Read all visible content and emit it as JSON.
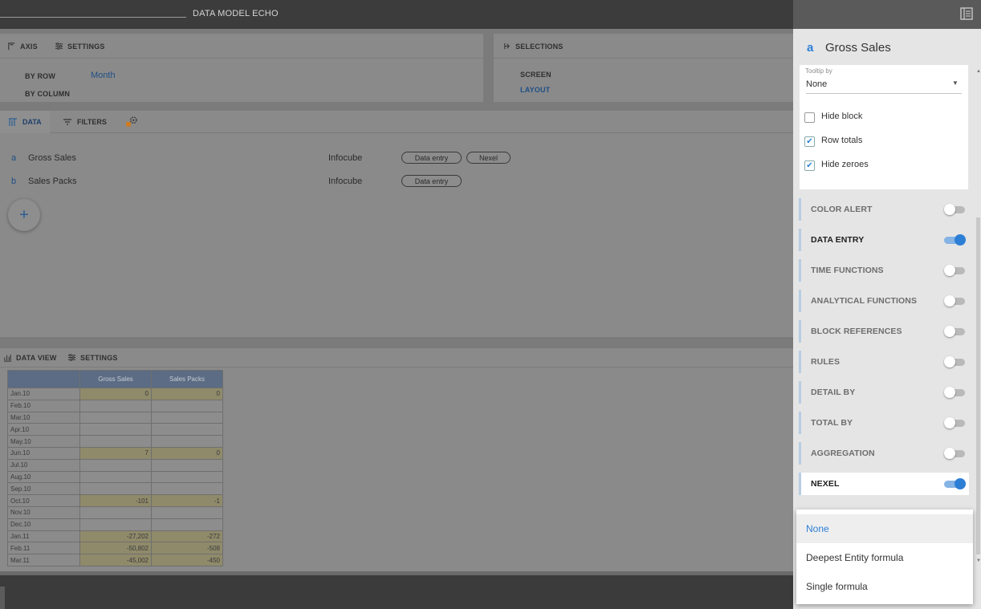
{
  "topbar": {
    "title": "DATA MODEL  ECHO"
  },
  "axis_panel": {
    "tab_axis": "AXIS",
    "tab_settings": "SETTINGS",
    "by_row_label": "BY ROW",
    "by_row_value": "Month",
    "by_column_label": "BY COLUMN"
  },
  "selections_panel": {
    "title": "SELECTIONS",
    "screen_label": "SCREEN",
    "layout_label": "LAYOUT"
  },
  "data_panel": {
    "tab_data": "DATA",
    "tab_filters": "FILTERS",
    "rows": [
      {
        "letter": "a",
        "name": "Gross Sales",
        "source": "Infocube",
        "pills": [
          "Data entry",
          "Nexel"
        ]
      },
      {
        "letter": "b",
        "name": "Sales Packs",
        "source": "Infocube",
        "pills": [
          "Data entry"
        ]
      }
    ],
    "add_label": "+"
  },
  "data_view": {
    "tab_data_view": "DATA VIEW",
    "tab_settings": "SETTINGS",
    "columns": [
      "Gross Sales",
      "Sales Packs"
    ],
    "rows": [
      {
        "label": "Jan.10",
        "v1": "0",
        "v2": "0",
        "hl": true
      },
      {
        "label": "Feb.10",
        "v1": "",
        "v2": "",
        "hl": false
      },
      {
        "label": "Mar.10",
        "v1": "",
        "v2": "",
        "hl": false
      },
      {
        "label": "Apr.10",
        "v1": "",
        "v2": "",
        "hl": false
      },
      {
        "label": "May.10",
        "v1": "",
        "v2": "",
        "hl": false
      },
      {
        "label": "Jun.10",
        "v1": "7",
        "v2": "0",
        "hl": true
      },
      {
        "label": "Jul.10",
        "v1": "",
        "v2": "",
        "hl": false
      },
      {
        "label": "Aug.10",
        "v1": "",
        "v2": "",
        "hl": false
      },
      {
        "label": "Sep.10",
        "v1": "",
        "v2": "",
        "hl": false
      },
      {
        "label": "Oct.10",
        "v1": "-101",
        "v2": "-1",
        "hl": true
      },
      {
        "label": "Nov.10",
        "v1": "",
        "v2": "",
        "hl": false
      },
      {
        "label": "Dec.10",
        "v1": "",
        "v2": "",
        "hl": false
      },
      {
        "label": "Jan.11",
        "v1": "-27,202",
        "v2": "-272",
        "hl": true
      },
      {
        "label": "Feb.11",
        "v1": "-50,802",
        "v2": "-508",
        "hl": true
      },
      {
        "label": "Mar.11",
        "v1": "-45,002",
        "v2": "-450",
        "hl": true
      }
    ]
  },
  "side_panel": {
    "letter": "a",
    "title": "Gross Sales",
    "tooltip_label": "Tooltip by",
    "tooltip_value": "None",
    "checkboxes": [
      {
        "label": "Hide block",
        "checked": false
      },
      {
        "label": "Row totals",
        "checked": true
      },
      {
        "label": "Hide zeroes",
        "checked": true
      }
    ],
    "features": [
      {
        "label": "COLOR ALERT",
        "on": false
      },
      {
        "label": "DATA ENTRY",
        "on": true
      },
      {
        "label": "TIME FUNCTIONS",
        "on": false
      },
      {
        "label": "ANALYTICAL FUNCTIONS",
        "on": false
      },
      {
        "label": "BLOCK REFERENCES",
        "on": false
      },
      {
        "label": "RULES",
        "on": false
      },
      {
        "label": "DETAIL BY",
        "on": false
      },
      {
        "label": "TOTAL BY",
        "on": false
      },
      {
        "label": "AGGREGATION",
        "on": false
      },
      {
        "label": "NEXEL",
        "on": true
      }
    ]
  },
  "dropdown": {
    "options": [
      "None",
      "Deepest Entity formula",
      "Single formula"
    ],
    "selected": "None"
  },
  "colors": {
    "accent": "#2d7fd6",
    "highlight_cell": "#8f8a6a"
  }
}
